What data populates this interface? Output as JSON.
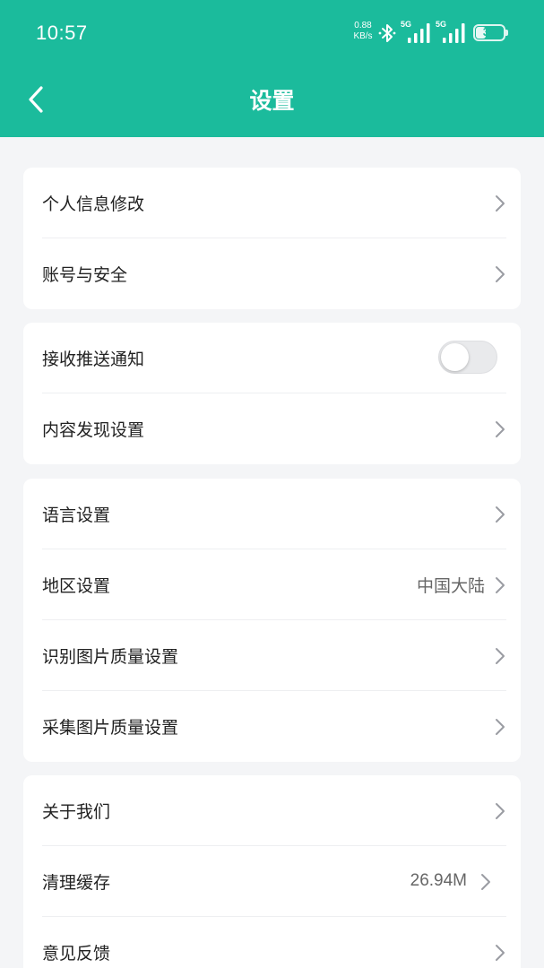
{
  "status_bar": {
    "time": "10:57",
    "net_speed_value": "0.88",
    "net_speed_unit": "KB/s",
    "sim1_label": "5G",
    "sim2_label": "5G",
    "battery_level": "33"
  },
  "header": {
    "title": "设置",
    "bg_color": "#1bbb9c"
  },
  "groups": [
    {
      "items": [
        {
          "label": "个人信息修改"
        },
        {
          "label": "账号与安全"
        }
      ]
    },
    {
      "items": [
        {
          "label": "接收推送通知",
          "toggle_on": false
        },
        {
          "label": "内容发现设置"
        }
      ]
    },
    {
      "items": [
        {
          "label": "语言设置"
        },
        {
          "label": "地区设置",
          "value": "中国大陆"
        },
        {
          "label": "识别图片质量设置"
        },
        {
          "label": "采集图片质量设置"
        }
      ]
    },
    {
      "items": [
        {
          "label": "关于我们"
        },
        {
          "label": "清理缓存",
          "value": "26.94M"
        },
        {
          "label": "意见反馈"
        }
      ]
    }
  ]
}
